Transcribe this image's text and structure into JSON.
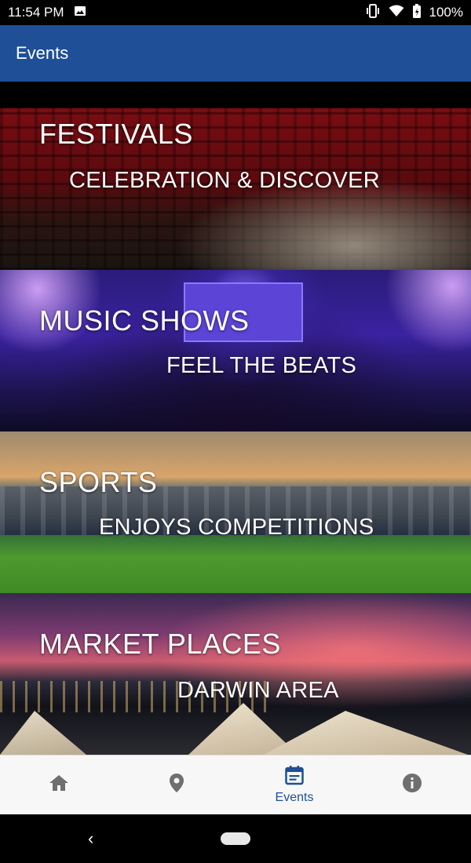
{
  "status_bar": {
    "time": "11:54 PM",
    "battery": "100%",
    "icons": [
      "image-icon",
      "vibrate-icon",
      "wifi-icon",
      "battery-icon"
    ]
  },
  "app_bar": {
    "title": "Events"
  },
  "banners": [
    {
      "title": "FESTIVALS",
      "subtitle": "CELEBRATION & DISCOVER"
    },
    {
      "title": "MUSIC SHOWS",
      "subtitle": "FEEL THE BEATS"
    },
    {
      "title": "SPORTS",
      "subtitle": "ENJOYS COMPETITIONS"
    },
    {
      "title": "MARKET PLACES",
      "subtitle": "DARWIN AREA"
    }
  ],
  "bottom_nav": {
    "items": [
      {
        "icon": "home-icon",
        "label": ""
      },
      {
        "icon": "location-pin-icon",
        "label": ""
      },
      {
        "icon": "calendar-icon",
        "label": "Events",
        "active": true
      },
      {
        "icon": "info-icon",
        "label": ""
      }
    ],
    "active_color": "#1e4f97",
    "inactive_color": "#6f6f6f"
  },
  "system_nav": {
    "back_glyph": "‹"
  },
  "colors": {
    "app_bar": "#1e4f97",
    "status_bar": "#000000"
  }
}
